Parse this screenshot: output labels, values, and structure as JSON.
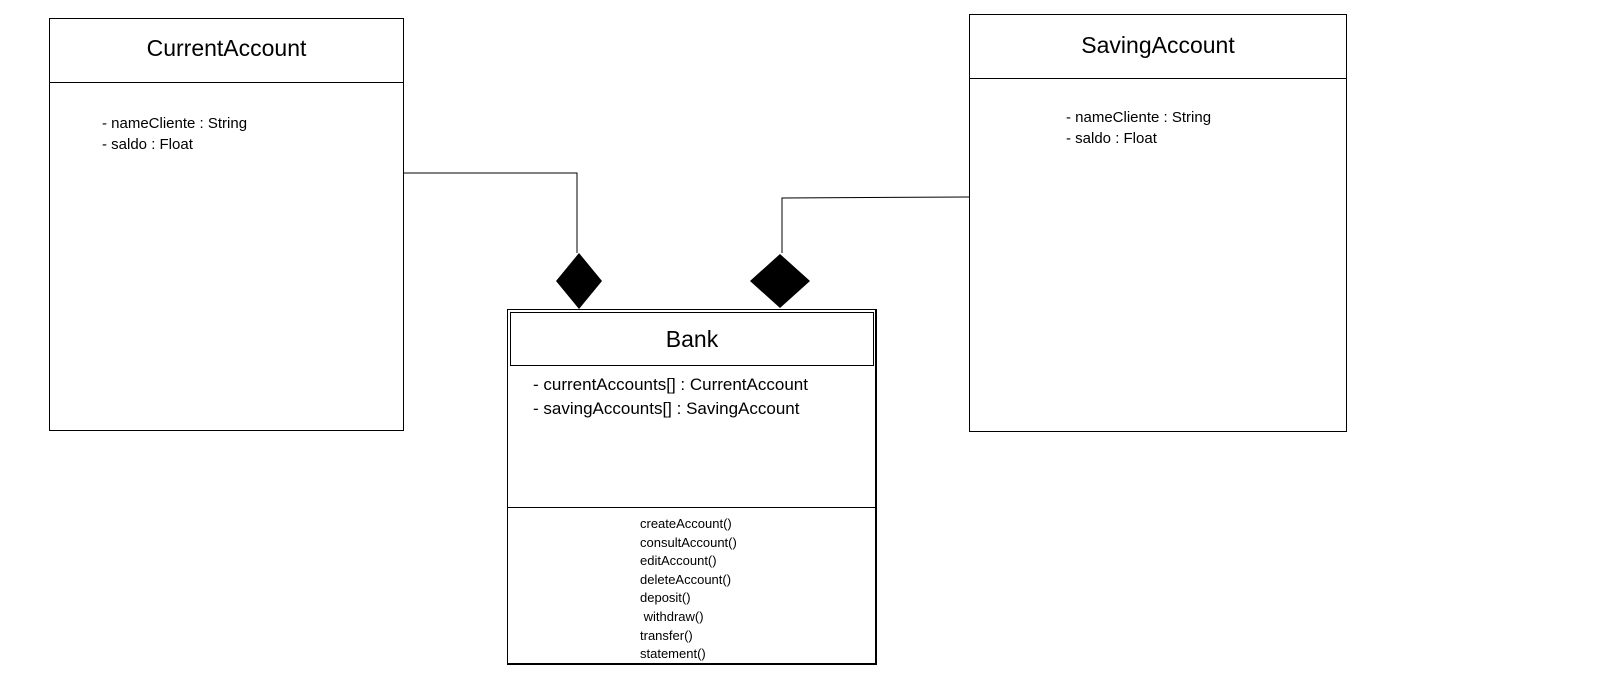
{
  "diagram": {
    "classes": {
      "current_account": {
        "name": "CurrentAccount",
        "attributes": [
          "- nameCliente : String",
          "- saldo : Float"
        ]
      },
      "saving_account": {
        "name": "SavingAccount",
        "attributes": [
          "- nameCliente : String",
          "- saldo : Float"
        ]
      },
      "bank": {
        "name": "Bank",
        "attributes": [
          "- currentAccounts[] : CurrentAccount",
          "- savingAccounts[] : SavingAccount"
        ],
        "methods": [
          "createAccount()",
          "consultAccount()",
          "editAccount()",
          "deleteAccount()",
          "deposit()",
          " withdraw()",
          "transfer()",
          "statement()"
        ]
      }
    },
    "relationships": [
      {
        "type": "composition",
        "whole": "Bank",
        "part": "CurrentAccount"
      },
      {
        "type": "composition",
        "whole": "Bank",
        "part": "SavingAccount"
      }
    ],
    "colors": {
      "line": "#000000",
      "background": "#ffffff"
    }
  }
}
